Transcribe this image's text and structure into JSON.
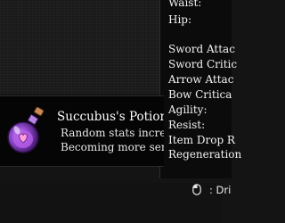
{
  "stats_panel": {
    "lines": [
      "Waist:",
      "Hip:",
      "",
      "Sword Attac",
      "Sword Critic",
      "Arrow Attac",
      "Bow Critica",
      "Agility:",
      "Resist:",
      "Item Drop R",
      "Regeneration"
    ]
  },
  "item": {
    "name": "Succubus's Potion",
    "description": [
      "Random stats increa",
      "Becoming more sen"
    ],
    "icon": "purple-potion-bottle-icon"
  },
  "footer": {
    "hint": ": Dri",
    "icon": "mouse-icon"
  },
  "colors": {
    "background": "#141414",
    "panel": "#0b0b0b",
    "potion_glass": "#9a4fd6",
    "text": "#f0f0f0"
  }
}
